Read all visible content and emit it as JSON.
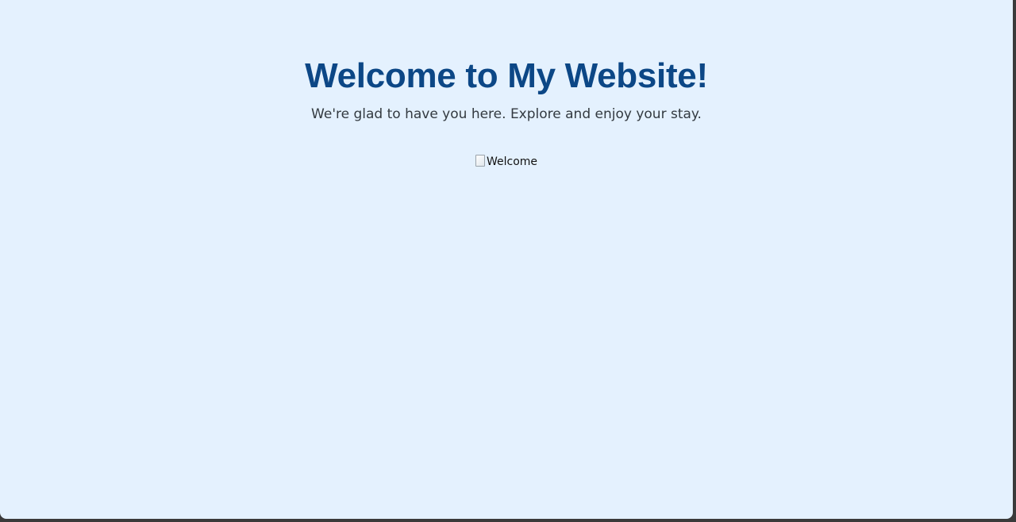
{
  "page": {
    "heading": "Welcome to My Website!",
    "subtitle": "We're glad to have you here. Explore and enjoy your stay.",
    "image": {
      "alt_text": "Welcome",
      "icon": "broken-image-icon"
    }
  },
  "colors": {
    "background": "#e4f1fe",
    "heading": "#0c4786",
    "subtitle": "#333a40"
  }
}
